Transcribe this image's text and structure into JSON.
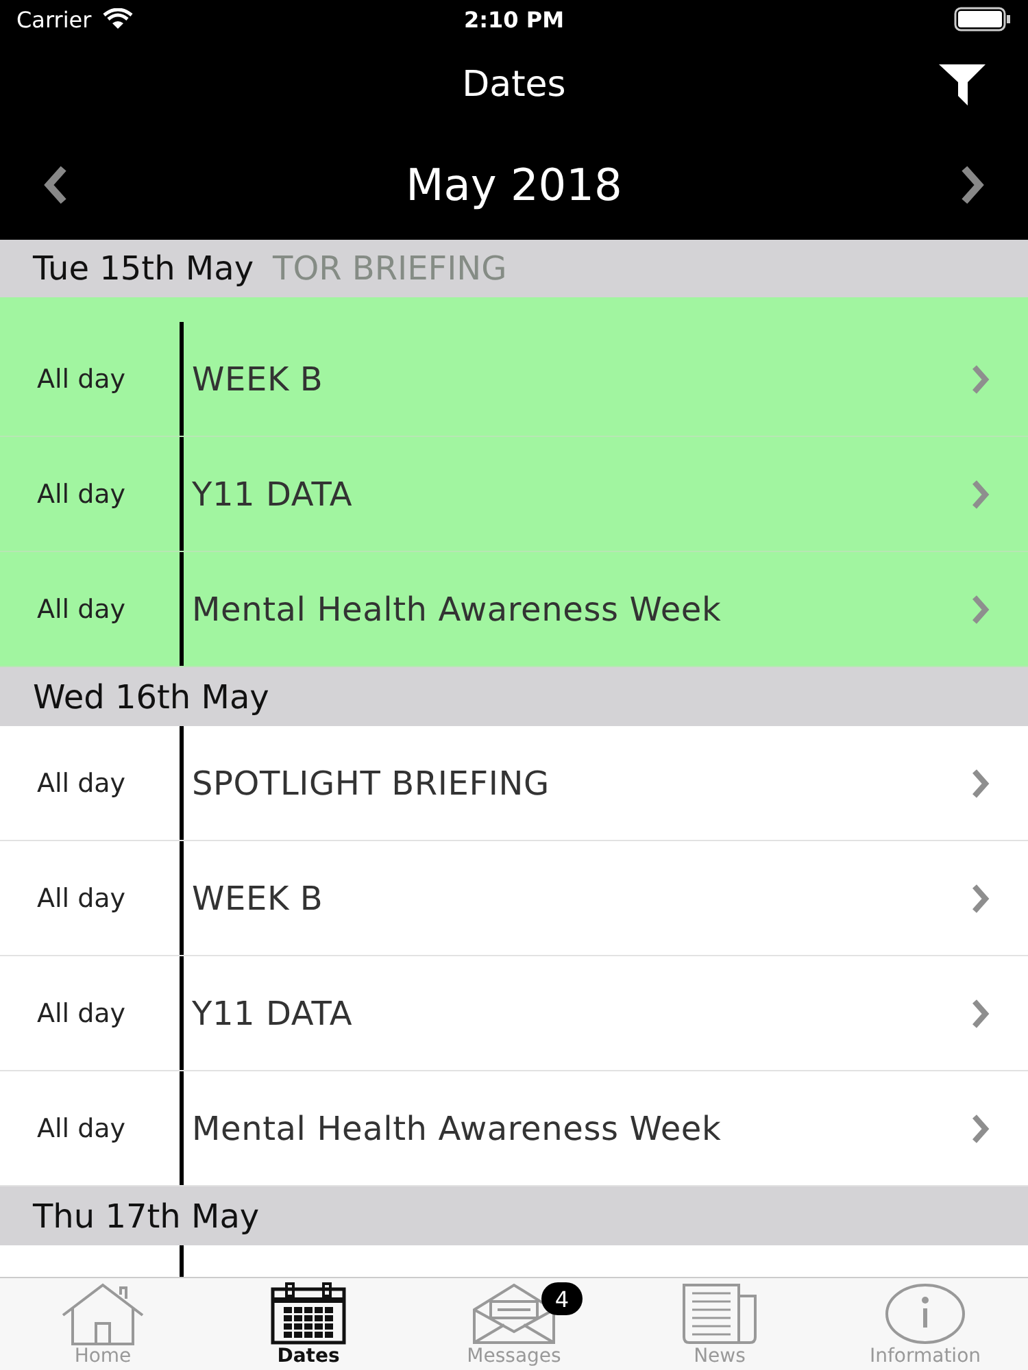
{
  "status_bar": {
    "carrier": "Carrier",
    "time": "2:10 PM"
  },
  "nav": {
    "title": "Dates"
  },
  "month": {
    "label": "May 2018"
  },
  "days": [
    {
      "label": "Tue 15th May",
      "covered_text": "TOR BRIEFING",
      "highlighted": true,
      "events": [
        {
          "time": "All day",
          "title": "WEEK B"
        },
        {
          "time": "All day",
          "title": "Y11 DATA"
        },
        {
          "time": "All day",
          "title": "Mental Health Awareness Week"
        }
      ]
    },
    {
      "label": "Wed 16th May",
      "highlighted": false,
      "events": [
        {
          "time": "All day",
          "title": "SPOTLIGHT BRIEFING"
        },
        {
          "time": "All day",
          "title": "WEEK B"
        },
        {
          "time": "All day",
          "title": "Y11 DATA"
        },
        {
          "time": "All day",
          "title": "Mental Health Awareness Week"
        }
      ]
    },
    {
      "label": "Thu 17th May",
      "highlighted": false
    }
  ],
  "tabs": [
    {
      "kind": "home",
      "label": "Home",
      "selected": false
    },
    {
      "kind": "dates",
      "label": "Dates",
      "selected": true
    },
    {
      "kind": "messages",
      "label": "Messages",
      "selected": false,
      "badge": "4"
    },
    {
      "kind": "news",
      "label": "News",
      "selected": false
    },
    {
      "kind": "info",
      "label": "Information",
      "selected": false
    }
  ]
}
